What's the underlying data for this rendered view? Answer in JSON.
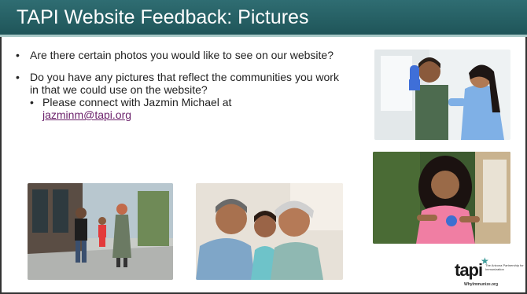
{
  "slide": {
    "title": "TAPI Website Feedback: Pictures",
    "bullets": [
      "Are there certain photos you would like to see on our website?",
      "Do you have any pictures that reflect the communities you work in that we could use on the website?"
    ],
    "sub_bullet": {
      "text": "Please connect with Jazmin Michael at",
      "email": "jazminm@tapi.org"
    },
    "bullet_char": "•"
  },
  "logo": {
    "word": "tapi",
    "tagline": "The Arizona Partnership for Immunization",
    "url": "WhyImmunize.org"
  },
  "colors": {
    "header": "#2f6d72",
    "accent_rule": "#a8c9c7",
    "link": "#6a1f6a"
  }
}
